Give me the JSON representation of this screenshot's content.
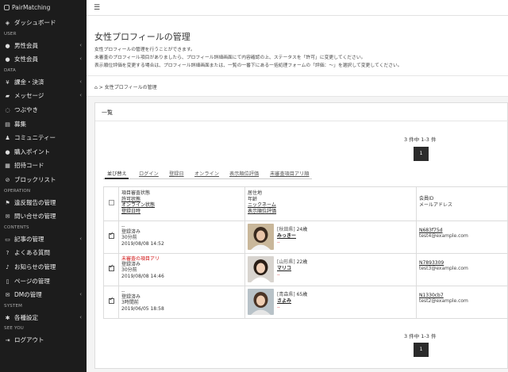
{
  "app": {
    "title": "PairMatching"
  },
  "sidebar": {
    "groups": [
      {
        "label": "",
        "items": [
          {
            "label": "ダッシュボード",
            "icon": "dashboard-icon",
            "glyph": "◈",
            "chev": false
          }
        ]
      },
      {
        "label": "USER",
        "items": [
          {
            "label": "男性会員",
            "icon": "user-icon",
            "glyph": "●",
            "chev": true
          },
          {
            "label": "女性会員",
            "icon": "user-icon",
            "glyph": "●",
            "chev": true
          }
        ]
      },
      {
        "label": "DATA",
        "items": [
          {
            "label": "課金・決済",
            "icon": "yen-icon",
            "glyph": "¥",
            "chev": true
          },
          {
            "label": "メッセージ",
            "icon": "chat-icon",
            "glyph": "▰",
            "chev": true
          },
          {
            "label": "つぶやき",
            "icon": "comment-icon",
            "glyph": "◌",
            "chev": false
          },
          {
            "label": "募集",
            "icon": "list-icon",
            "glyph": "▤",
            "chev": false
          },
          {
            "label": "コミュニティー",
            "icon": "group-icon",
            "glyph": "♟",
            "chev": false
          },
          {
            "label": "購入ポイント",
            "icon": "coin-icon",
            "glyph": "●",
            "chev": false
          },
          {
            "label": "招待コード",
            "icon": "code-icon",
            "glyph": "▦",
            "chev": false
          },
          {
            "label": "ブロックリスト",
            "icon": "block-icon",
            "glyph": "⊘",
            "chev": false
          }
        ]
      },
      {
        "label": "OPERATION",
        "items": [
          {
            "label": "違反報告の管理",
            "icon": "flag-icon",
            "glyph": "⚑",
            "chev": false
          },
          {
            "label": "問い合せの管理",
            "icon": "inquiry-icon",
            "glyph": "✉",
            "chev": false
          }
        ]
      },
      {
        "label": "CONTENTS",
        "items": [
          {
            "label": "記事の管理",
            "icon": "article-icon",
            "glyph": "▭",
            "chev": true
          },
          {
            "label": "よくある質問",
            "icon": "question-icon",
            "glyph": "?",
            "chev": false
          },
          {
            "label": "お知らせの管理",
            "icon": "bell-icon",
            "glyph": "♪",
            "chev": false
          },
          {
            "label": "ページの管理",
            "icon": "page-icon",
            "glyph": "▯",
            "chev": false
          },
          {
            "label": "DMの管理",
            "icon": "dm-icon",
            "glyph": "✉",
            "chev": true
          }
        ]
      },
      {
        "label": "SYSTEM",
        "items": [
          {
            "label": "各種設定",
            "icon": "gear-icon",
            "glyph": "✱",
            "chev": true
          }
        ]
      },
      {
        "label": "SEE YOU",
        "items": [
          {
            "label": "ログアウト",
            "icon": "logout-icon",
            "glyph": "⇥",
            "chev": false
          }
        ]
      }
    ]
  },
  "page": {
    "title": "女性プロフィールの管理",
    "desc": [
      "女性プロフィールの管理を行うことができます。",
      "未審査のプロフィール項目がありましたら、プロフィール詳細画面にて内容確認の上、ステータスを「許可」に変更してください。",
      "表示順位評価を変更する場合は、プロフィール詳細画面または、一覧の一番下にある一括処理フォームの「評価：～」を選択して変更してください。"
    ],
    "breadcrumb": {
      "sep": ">",
      "current": "女性プロフィールの管理"
    }
  },
  "list": {
    "title": "一覧",
    "count_text": "3 件中 1-3 件",
    "page_number": "1",
    "sort_label": "並び替え",
    "sort_tabs": [
      "ログイン",
      "登録日",
      "オンライン",
      "表示順位評価",
      "未審査項目アリ順"
    ],
    "headers": {
      "col_a": [
        "項目審査状態",
        "許可状態",
        "オンライン状態",
        "登録日時"
      ],
      "col_b": [
        "居住地",
        "年齢",
        "ニックネーム",
        "表示順位評価"
      ],
      "col_c": [
        "会員ID",
        "メールアドレス"
      ]
    },
    "rows": [
      {
        "checked": true,
        "review": "--",
        "status": "登録済み",
        "online": "30分前",
        "date": "2019/08/08 14:52",
        "pref": "[秋田県]",
        "age": "24歳",
        "nick": "みっきー",
        "eval": "--",
        "id": "N683f75d",
        "email": "test4@example.com"
      },
      {
        "checked": true,
        "review": "未審査の項目アリ",
        "status": "登録済み",
        "online": "30分前",
        "date": "2019/08/08 14:46",
        "pref": "[山形県]",
        "age": "22歳",
        "nick": "マリコ",
        "eval": "--",
        "id": "N7893309",
        "email": "test3@example.com"
      },
      {
        "checked": true,
        "review": "--",
        "status": "登録済み",
        "online": "3時間前",
        "date": "2019/06/05 18:58",
        "pref": "[青森県]",
        "age": "65歳",
        "nick": "さよみ",
        "eval": "--",
        "id": "N1330cb7",
        "email": "test2@example.com"
      }
    ]
  }
}
